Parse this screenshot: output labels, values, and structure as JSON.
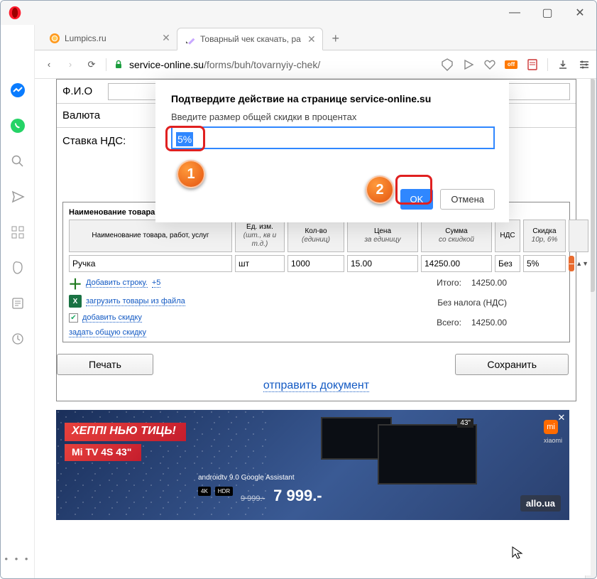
{
  "window": {
    "min": "—",
    "max": "▢",
    "close": "✕"
  },
  "tabs": [
    {
      "label": "Lumpics.ru",
      "active": false
    },
    {
      "label": "Товарный чек скачать, ра",
      "active": true
    }
  ],
  "newtab": "+",
  "nav": {
    "back": "‹",
    "forward": "›",
    "reload": "⟳"
  },
  "url": {
    "host": "service-online.su",
    "path": "/forms/buh/tovarnyiy-chek/"
  },
  "ext": {
    "off": "off"
  },
  "sidebar": {
    "dots": "• • •"
  },
  "form": {
    "fio": "Ф.И.О",
    "currency": "Валюта",
    "vat": "Ставка НДС:"
  },
  "dialog": {
    "title": "Подтвердите действие на странице service-online.su",
    "message": "Введите размер общей скидки в процентах",
    "value": "5%",
    "ok": "OK",
    "cancel": "Отмена"
  },
  "callouts": {
    "one": "1",
    "two": "2"
  },
  "table": {
    "caption": "Наименование товара, работ, услуг, подлежащих оплате:",
    "headers": {
      "name": "Наименование товара, работ, услуг",
      "unit": "Ед. изм.",
      "unit_sub": "(шт., кв и т.д.)",
      "qty": "Кол-во",
      "qty_sub": "(единиц)",
      "price": "Цена",
      "price_sub": "за единицу",
      "sum": "Сумма",
      "sum_sub": "со скидкой",
      "nds": "НДС",
      "discount": "Скидка",
      "discount_sub": "10р, 6%"
    },
    "row": {
      "name": "Ручка",
      "unit": "шт",
      "qty": "1000",
      "price": "15.00",
      "sum": "14250.00",
      "nds": "Без",
      "discount": "5%",
      "delete": "−"
    }
  },
  "links": {
    "add_row": "Добавить строку.",
    "add_five": "+5",
    "load_excel": "загрузить товары из файла",
    "add_discount": "добавить скидку",
    "set_total_discount": "задать общую скидку"
  },
  "totals": {
    "itogo_label": "Итого:",
    "itogo_value": "14250.00",
    "notax": "Без налога (НДС)",
    "vsego_label": "Всего:",
    "vsego_value": "14250.00"
  },
  "buttons": {
    "print": "Печать",
    "save": "Сохранить"
  },
  "send_link": "отправить документ",
  "ad": {
    "line1": "ХЕППI НЬЮ ТИЦЬ!",
    "line2": "Mi TV 4S 43\"",
    "atv": "androidtv 9.0  Google Assistant",
    "k4": "4K",
    "hdr": "HDR",
    "old_price": "9 999.-",
    "new_price": "7 999.-",
    "tvlabel": "43\"",
    "mi_label": "xiaomi",
    "mi": "mi",
    "allo": "allo.ua",
    "close": "✕"
  }
}
